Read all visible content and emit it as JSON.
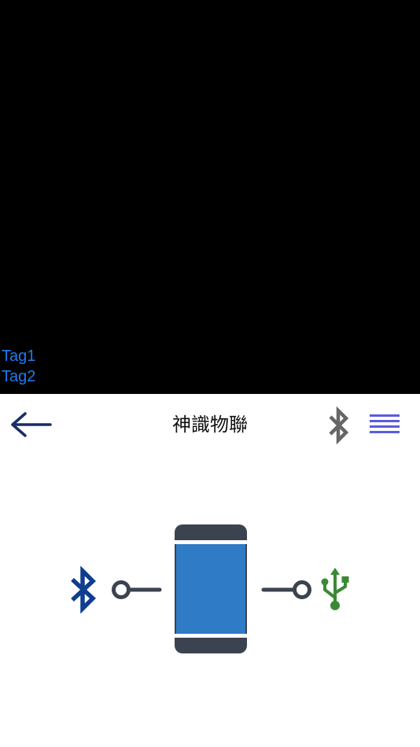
{
  "tags": [
    {
      "label": "Tag1"
    },
    {
      "label": "Tag2"
    }
  ],
  "nav": {
    "title": "神識物聯",
    "back_icon": "arrow-left-icon",
    "bluetooth_icon": "bluetooth-icon",
    "menu_icon": "hamburger-menu-icon"
  },
  "diagram": {
    "left_icon": "bluetooth-icon",
    "center_icon": "smartphone-icon",
    "right_icon": "usb-icon"
  },
  "colors": {
    "video_background": "#000000",
    "tag_text": "#1e7bf0",
    "back_arrow": "#1a2d66",
    "nav_bluetooth": "#666666",
    "menu": "#5b5be0",
    "diagram_bluetooth": "#0f3d8f",
    "connector": "#3c4350",
    "phone_body": "#3c4350",
    "phone_screen": "#2f7bc6",
    "usb": "#3a8a35"
  }
}
